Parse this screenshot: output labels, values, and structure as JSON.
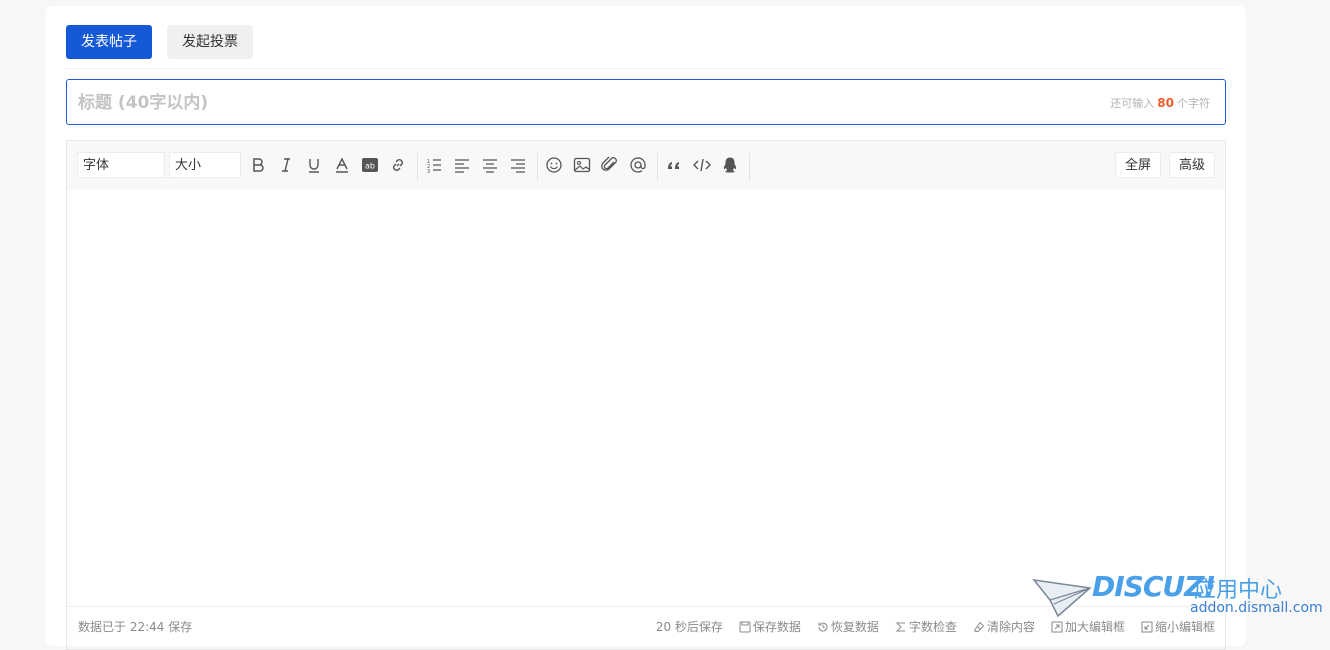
{
  "tabs": [
    {
      "label": "发表帖子",
      "active": true
    },
    {
      "label": "发起投票",
      "active": false
    }
  ],
  "title": {
    "placeholder": "标题 (40字以内)",
    "value": "",
    "counter_prefix": "还可输入",
    "counter_num": "80",
    "counter_suffix": "个字符"
  },
  "toolbar": {
    "font_select": "字体",
    "size_select": "大小",
    "icons": [
      "bold-icon",
      "italic-icon",
      "underline-icon",
      "font-color-icon",
      "background-color-icon",
      "link-icon",
      "ordered-list-icon",
      "align-left-icon",
      "align-center-icon",
      "align-right-icon",
      "emoji-icon",
      "image-icon",
      "attachment-icon",
      "mention-icon",
      "quote-icon",
      "code-icon",
      "qq-icon"
    ],
    "fullscreen_label": "全屏",
    "advanced_label": "高级"
  },
  "status": {
    "saved_text": "数据已于 22:44 保存",
    "autosave_text": "20 秒后保存",
    "save_data": "保存数据",
    "restore_data": "恢复数据",
    "word_check": "字数检查",
    "clear_content": "清除内容",
    "enlarge_editor": "加大编辑框",
    "shrink_editor": "缩小编辑框"
  },
  "watermark": {
    "brand": "DISCUZ!",
    "cn": "应用中心",
    "url": "addon.dismall.com"
  },
  "colors": {
    "accent": "#1659d6",
    "counter_num": "#f25c2e",
    "watermark": "#4aa0e8"
  }
}
